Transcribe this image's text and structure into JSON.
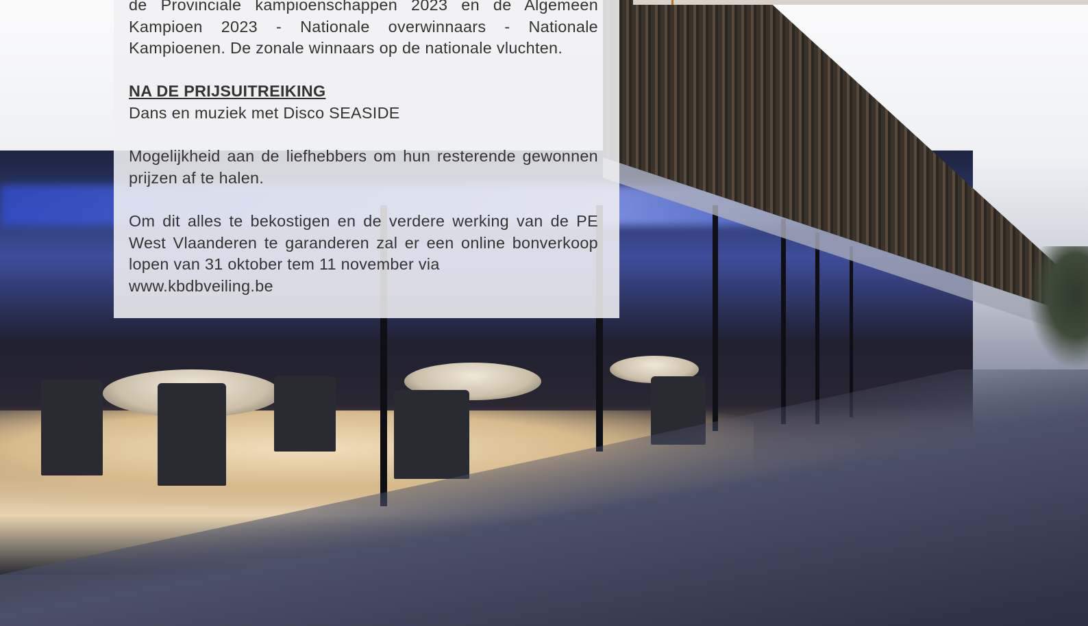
{
  "content": {
    "intro": "de Provinciale kampioenschappen 2023 en de Algemeen Kampioen 2023  -   Nationale overwinnaars - Nationale Kampioenen. De zonale winnaars op de nationale vluchten.",
    "after_heading": "NA DE PRIJSUITREIKING",
    "dance": "Dans en muziek met  Disco SEASIDE",
    "collect": "Mogelijkheid aan de liefhebbers om hun resterende gewonnen prijzen af te halen.",
    "funding": "Om dit alles te bekostigen en de verdere werking van de PE West Vlaanderen te garanderen zal er een online bonverkoop lopen van 31 oktober tem 11 november via",
    "website": "www.kbdbveiling.be"
  },
  "colors": {
    "heading": "#2aa2c6",
    "text": "#333333",
    "panel_bg": "rgba(240,240,242,0.88)"
  }
}
